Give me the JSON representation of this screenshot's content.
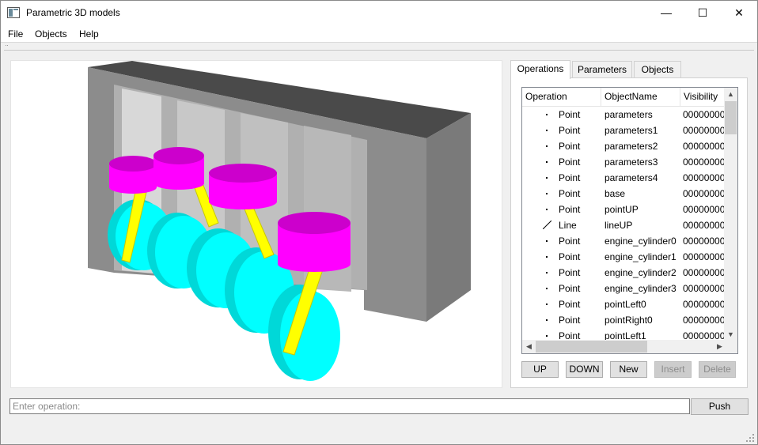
{
  "window": {
    "title": "Parametric 3D models",
    "minimize_glyph": "—",
    "maximize_glyph": "☐",
    "close_glyph": "✕"
  },
  "menu": [
    "File",
    "Objects",
    "Help"
  ],
  "viewport": {
    "colors": {
      "block_top": "#4a4a4a",
      "block_front": "#8c8c8c",
      "block_side": "#7a7a7a",
      "piston": "#ff00ff",
      "rod": "#ffff00",
      "crank": "#00ffff"
    }
  },
  "tabs": [
    {
      "label": "Operations",
      "active": true
    },
    {
      "label": "Parameters",
      "active": false
    },
    {
      "label": "Objects",
      "active": false
    }
  ],
  "table": {
    "columns": [
      "Operation",
      "ObjectName",
      "Visibility"
    ],
    "rows": [
      {
        "icon": "point-icon",
        "operation": "Point",
        "name": "parameters",
        "visibility": "00000000"
      },
      {
        "icon": "point-icon",
        "operation": "Point",
        "name": "parameters1",
        "visibility": "00000000"
      },
      {
        "icon": "point-icon",
        "operation": "Point",
        "name": "parameters2",
        "visibility": "00000000"
      },
      {
        "icon": "point-icon",
        "operation": "Point",
        "name": "parameters3",
        "visibility": "00000000"
      },
      {
        "icon": "point-icon",
        "operation": "Point",
        "name": "parameters4",
        "visibility": "00000000"
      },
      {
        "icon": "point-icon",
        "operation": "Point",
        "name": "base",
        "visibility": "00000000"
      },
      {
        "icon": "point-icon",
        "operation": "Point",
        "name": "pointUP",
        "visibility": "00000000"
      },
      {
        "icon": "line-icon",
        "operation": "Line",
        "name": "lineUP",
        "visibility": "00000000"
      },
      {
        "icon": "point-icon",
        "operation": "Point",
        "name": "engine_cylinder0",
        "visibility": "00000000"
      },
      {
        "icon": "point-icon",
        "operation": "Point",
        "name": "engine_cylinder1",
        "visibility": "00000000"
      },
      {
        "icon": "point-icon",
        "operation": "Point",
        "name": "engine_cylinder2",
        "visibility": "00000000"
      },
      {
        "icon": "point-icon",
        "operation": "Point",
        "name": "engine_cylinder3",
        "visibility": "00000000"
      },
      {
        "icon": "point-icon",
        "operation": "Point",
        "name": "pointLeft0",
        "visibility": "00000000"
      },
      {
        "icon": "point-icon",
        "operation": "Point",
        "name": "pointRight0",
        "visibility": "00000000"
      },
      {
        "icon": "point-icon",
        "operation": "Point",
        "name": "pointLeft1",
        "visibility": "00000000"
      }
    ]
  },
  "buttons": [
    {
      "label": "UP",
      "enabled": true
    },
    {
      "label": "DOWN",
      "enabled": true
    },
    {
      "label": "New",
      "enabled": true
    },
    {
      "label": "Insert",
      "enabled": false
    },
    {
      "label": "Delete",
      "enabled": false
    }
  ],
  "operation_input": {
    "placeholder": "Enter operation:",
    "value": ""
  },
  "push_label": "Push"
}
